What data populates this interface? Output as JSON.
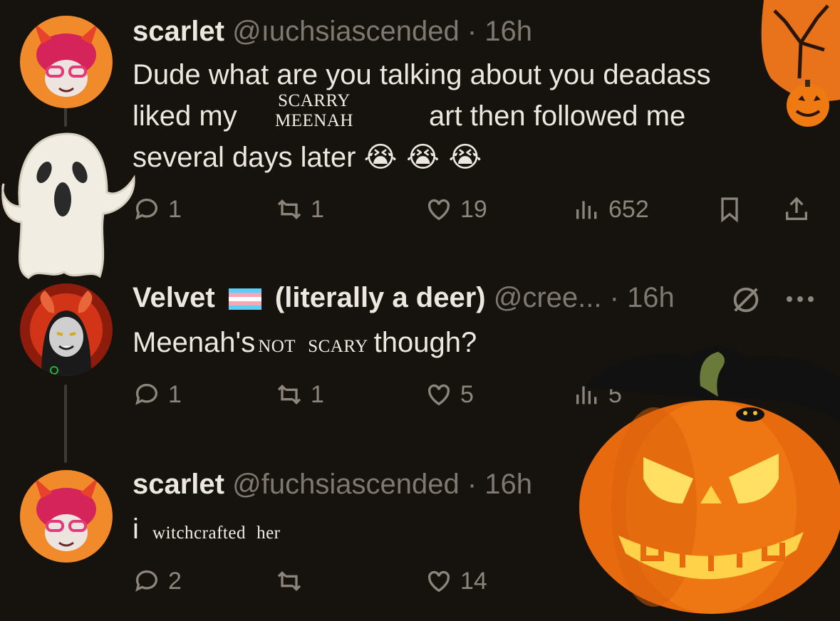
{
  "tweets": [
    {
      "name": "scarlet",
      "handle": "@ıuchsiascended",
      "sep": "·",
      "time": "16h",
      "text_a": "Dude what are you talking about you deadass",
      "text_b_start": "liked my",
      "sticker_top": "SCARRY",
      "sticker_bottom": "MEENAH",
      "text_b_end": "art then followed me",
      "text_c": "several days later",
      "emojis": "😭 😭 😭",
      "replies": "1",
      "reposts": "1",
      "likes": "19",
      "views": "652"
    },
    {
      "name": "Velvet",
      "flag": "🏳️‍⚧️",
      "name_suffix": "(literally a deer)",
      "handle": "@cree...",
      "sep": "·",
      "time": "16h",
      "text_start": "Meenah's",
      "sticker_a": "NOT",
      "sticker_b": "SCARY",
      "text_end": "though?",
      "replies": "1",
      "reposts": "1",
      "likes": "5",
      "views": "5"
    },
    {
      "name": "scarlet",
      "handle": "@fuchsiascended",
      "sep": "·",
      "time": "16h",
      "text_start": "i",
      "sticker_a": "witchcrafted",
      "sticker_b": "her",
      "replies": "2",
      "likes": "14"
    }
  ],
  "colors": {
    "background": "#16120d",
    "text": "#ece7df",
    "muted": "#8b857c",
    "pumpkin": "#f07a12"
  },
  "icons": [
    "reply-icon",
    "repost-icon",
    "like-icon",
    "views-icon",
    "bookmark-icon",
    "share-icon",
    "more-icon",
    "mute-icon"
  ]
}
